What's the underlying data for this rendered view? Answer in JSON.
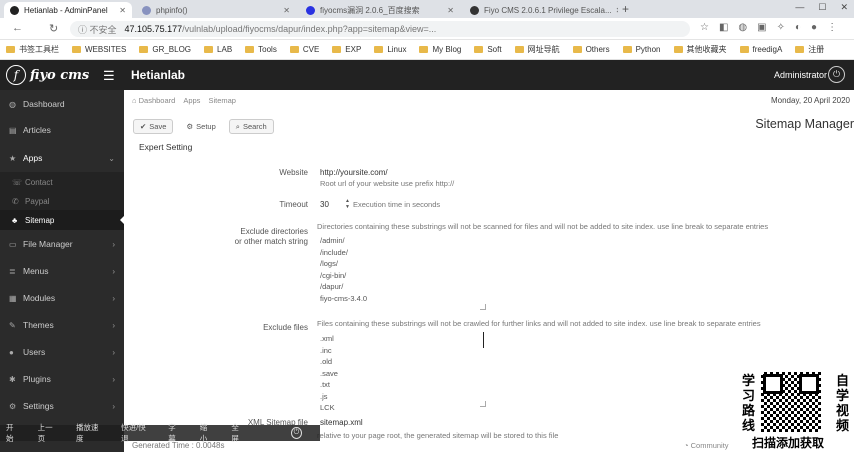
{
  "browser": {
    "tabs": [
      {
        "title": "Hetianlab - AdminPanel",
        "active": true
      },
      {
        "title": "phpinfo()",
        "active": false
      },
      {
        "title": "fiyocms漏洞 2.0.6_百度搜索",
        "active": false
      },
      {
        "title": "Fiyo CMS 2.0.6.1 Privilege Escala...",
        "active": false
      }
    ],
    "insecure_label": "不安全",
    "url_host": "47.105.75.177",
    "url_path": "/vulnlab/upload/fiyocms/dapur/index.php?app=sitemap&view=...",
    "bookmarks": [
      "书签工具栏",
      "WEBSITES",
      "GR_BLOG",
      "LAB",
      "Tools",
      "CVE",
      "EXP",
      "Linux",
      "My Blog",
      "Soft",
      "网址导航",
      "Others",
      "Python",
      "其他收藏夹",
      "freedigA",
      "注册"
    ]
  },
  "app": {
    "logo_text": "fiyo cms",
    "name": "Hetianlab",
    "admin": "Administrator"
  },
  "sidebar": {
    "items": [
      {
        "label": "Dashboard",
        "icon": "dashboard-icon",
        "glyph": "◍"
      },
      {
        "label": "Articles",
        "icon": "articles-icon",
        "glyph": "▤"
      },
      {
        "label": "Apps",
        "icon": "star-icon",
        "glyph": "★"
      },
      {
        "label": "File Manager",
        "icon": "folder-icon",
        "glyph": "▭"
      },
      {
        "label": "Menus",
        "icon": "menus-icon",
        "glyph": "≣"
      },
      {
        "label": "Modules",
        "icon": "modules-icon",
        "glyph": "▦"
      },
      {
        "label": "Themes",
        "icon": "themes-icon",
        "glyph": "✎"
      },
      {
        "label": "Users",
        "icon": "users-icon",
        "glyph": "●"
      },
      {
        "label": "Plugins",
        "icon": "plugins-icon",
        "glyph": "✱"
      },
      {
        "label": "Settings",
        "icon": "settings-icon",
        "glyph": "⚙"
      }
    ],
    "apps_sub": [
      {
        "label": "Contact",
        "glyph": "☏"
      },
      {
        "label": "Paypal",
        "glyph": "✆"
      },
      {
        "label": "Sitemap",
        "glyph": "♣"
      }
    ]
  },
  "main": {
    "breadcrumb": [
      "Dashboard",
      "Apps",
      "Sitemap"
    ],
    "date": "Monday, 20 April 2020",
    "toolbar": {
      "save": "Save",
      "setup": "Setup",
      "search": "Search"
    },
    "page_title": "Sitemap Manager",
    "section": "Expert Setting",
    "website_label": "Website",
    "website_value": "http://yoursite.com/",
    "website_help": "Root url of your website use prefix http://",
    "timeout_label": "Timeout",
    "timeout_value": "30",
    "timeout_help": "Execution time in seconds",
    "exclude_dirs_label1": "Exclude directories",
    "exclude_dirs_label2": "or other match string",
    "exclude_dirs_help": "Directories containing these substrings will not be scanned for files and will not be added to site index. use line break to separate entries",
    "exclude_dirs": [
      "/admin/",
      "/include/",
      "/logs/",
      "/cgi-bin/",
      "/dapur/",
      "fiyo-cms-3.4.0"
    ],
    "exclude_files_label": "Exclude files",
    "exclude_files_help": "Files containing these substrings will not be crawled for further links and will not added to site index. use line break to separate entries",
    "exclude_files": [
      ".xml",
      ".inc",
      ".old",
      ".save",
      ".txt",
      ".js",
      "LCK"
    ],
    "xml_label": "XML Sitemap file",
    "xml_value": "sitemap.xml",
    "xml_help": "relative to your page root, the generated sitemap will be stored to this file",
    "generated": "Generated Time : 0.0048s",
    "community": "Community"
  },
  "player": {
    "buttons": [
      "开始",
      "上一页",
      "播放速度",
      "快进/快退",
      "字幕",
      "缩小",
      "全屏"
    ]
  },
  "promo": {
    "left": "学习路线",
    "right": "自学视频",
    "bottom": "扫描添加获取"
  }
}
